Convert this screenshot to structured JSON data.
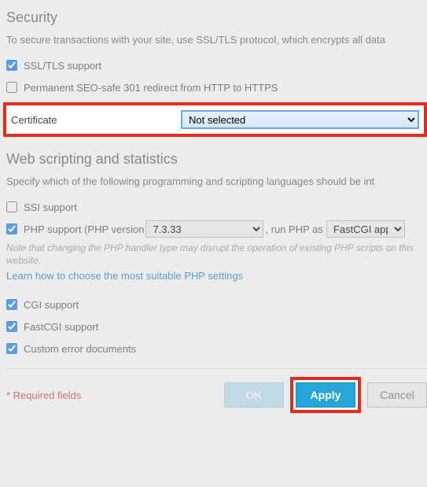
{
  "security": {
    "heading": "Security",
    "desc": "To secure transactions with your site, use SSL/TLS protocol, which encrypts all data",
    "ssl_tls_label": "SSL/TLS support",
    "ssl_tls_checked": true,
    "redirect_label": "Permanent SEO-safe 301 redirect from HTTP to HTTPS",
    "redirect_checked": false,
    "certificate_label": "Certificate",
    "certificate_value": "Not selected"
  },
  "scripting": {
    "heading": "Web scripting and statistics",
    "desc": "Specify which of the following programming and scripting languages should be int",
    "ssi_label": "SSI support",
    "ssi_checked": false,
    "php_label": "PHP support (PHP version",
    "php_version": "7.3.33",
    "php_run_as_label": ", run PHP as",
    "php_handler": "FastCGI applic",
    "php_note": "Note that changing the PHP handler type may disrupt the operation of existing PHP scripts on this website.",
    "php_link": "Learn how to choose the most suitable PHP settings",
    "cgi_label": "CGI support",
    "cgi_checked": true,
    "fastcgi_label": "FastCGI support",
    "fastcgi_checked": true,
    "custom_err_label": "Custom error documents",
    "custom_err_checked": true
  },
  "footer": {
    "required": "* Required fields",
    "ok": "OK",
    "apply": "Apply",
    "cancel": "Cancel"
  }
}
